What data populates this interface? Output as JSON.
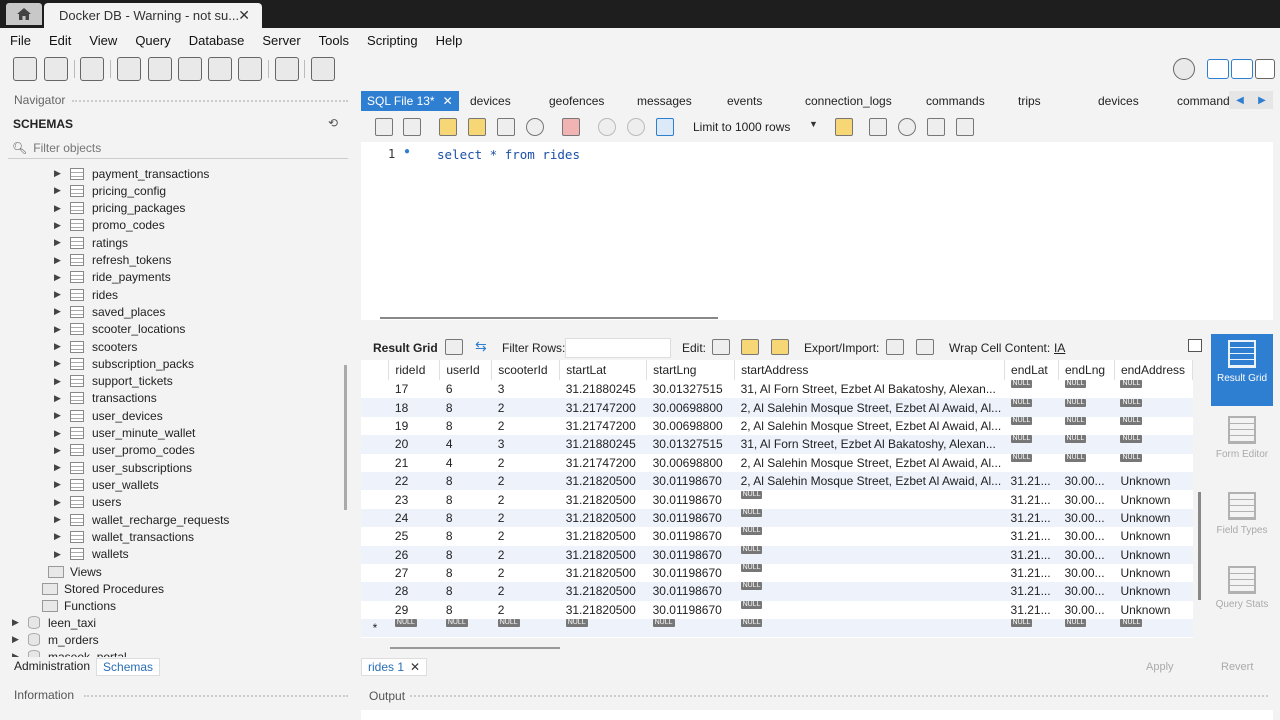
{
  "window": {
    "tab_title": "Docker DB - Warning - not su...",
    "close_glyph": "✕"
  },
  "menu": [
    "File",
    "Edit",
    "View",
    "Query",
    "Database",
    "Server",
    "Tools",
    "Scripting",
    "Help"
  ],
  "navigator": {
    "title": "Navigator",
    "schemas_label": "SCHEMAS",
    "filter_placeholder": "Filter objects",
    "tables": [
      "payment_transactions",
      "pricing_config",
      "pricing_packages",
      "promo_codes",
      "ratings",
      "refresh_tokens",
      "ride_payments",
      "rides",
      "saved_places",
      "scooter_locations",
      "scooters",
      "subscription_packs",
      "support_tickets",
      "transactions",
      "user_devices",
      "user_minute_wallet",
      "user_promo_codes",
      "user_subscriptions",
      "user_wallets",
      "users",
      "wallet_recharge_requests",
      "wallet_transactions",
      "wallets"
    ],
    "folders": [
      "Views",
      "Stored Procedures",
      "Functions"
    ],
    "schemas": [
      "leen_taxi",
      "m_orders",
      "maseek_portal"
    ],
    "bottom_tabs": [
      "Administration",
      "Schemas"
    ],
    "info_title": "Information"
  },
  "editor_tabs": [
    "SQL File 13*",
    "devices",
    "geofences",
    "messages",
    "events",
    "connection_logs",
    "commands",
    "trips",
    "devices",
    "command"
  ],
  "editor_toolbar": {
    "limit_label": "Limit to 1000 rows"
  },
  "editor": {
    "line_number": "1",
    "sql": "select * from rides"
  },
  "result_toolbar": {
    "result_grid": "Result Grid",
    "filter_rows": "Filter Rows:",
    "edit": "Edit:",
    "export_import": "Export/Import:",
    "wrap_cell": "Wrap Cell Content:"
  },
  "grid": {
    "columns": [
      "rideId",
      "userId",
      "scooterId",
      "startLat",
      "startLng",
      "startAddress",
      "endLat",
      "endLng",
      "endAddress"
    ],
    "null_label": "NULL",
    "rows": [
      [
        "17",
        "6",
        "3",
        "31.21880245",
        "30.01327515",
        "31, Al Forn Street, Ezbet Al Bakatoshy, Alexan...",
        "NULL",
        "NULL",
        "NULL"
      ],
      [
        "18",
        "8",
        "2",
        "31.21747200",
        "30.00698800",
        "2, Al Salehin Mosque Street, Ezbet Al Awaid, Al...",
        "NULL",
        "NULL",
        "NULL"
      ],
      [
        "19",
        "8",
        "2",
        "31.21747200",
        "30.00698800",
        "2, Al Salehin Mosque Street, Ezbet Al Awaid, Al...",
        "NULL",
        "NULL",
        "NULL"
      ],
      [
        "20",
        "4",
        "3",
        "31.21880245",
        "30.01327515",
        "31, Al Forn Street, Ezbet Al Bakatoshy, Alexan...",
        "NULL",
        "NULL",
        "NULL"
      ],
      [
        "21",
        "4",
        "2",
        "31.21747200",
        "30.00698800",
        "2, Al Salehin Mosque Street, Ezbet Al Awaid, Al...",
        "NULL",
        "NULL",
        "NULL"
      ],
      [
        "22",
        "8",
        "2",
        "31.21820500",
        "30.01198670",
        "2, Al Salehin Mosque Street, Ezbet Al Awaid, Al...",
        "31.21...",
        "30.00...",
        "Unknown"
      ],
      [
        "23",
        "8",
        "2",
        "31.21820500",
        "30.01198670",
        "NULL",
        "31.21...",
        "30.00...",
        "Unknown"
      ],
      [
        "24",
        "8",
        "2",
        "31.21820500",
        "30.01198670",
        "NULL",
        "31.21...",
        "30.00...",
        "Unknown"
      ],
      [
        "25",
        "8",
        "2",
        "31.21820500",
        "30.01198670",
        "NULL",
        "31.21...",
        "30.00...",
        "Unknown"
      ],
      [
        "26",
        "8",
        "2",
        "31.21820500",
        "30.01198670",
        "NULL",
        "31.21...",
        "30.00...",
        "Unknown"
      ],
      [
        "27",
        "8",
        "2",
        "31.21820500",
        "30.01198670",
        "NULL",
        "31.21...",
        "30.00...",
        "Unknown"
      ],
      [
        "28",
        "8",
        "2",
        "31.21820500",
        "30.01198670",
        "NULL",
        "31.21...",
        "30.00...",
        "Unknown"
      ],
      [
        "29",
        "8",
        "2",
        "31.21820500",
        "30.01198670",
        "NULL",
        "31.21...",
        "30.00...",
        "Unknown"
      ],
      [
        "NULL",
        "NULL",
        "NULL",
        "NULL",
        "NULL",
        "NULL",
        "NULL",
        "NULL",
        "NULL"
      ]
    ],
    "new_row_marker": "*"
  },
  "right_panel": [
    "Result Grid",
    "Form Editor",
    "Field Types",
    "Query Stats"
  ],
  "result_tab": "rides 1",
  "buttons": {
    "apply": "Apply",
    "revert": "Revert"
  },
  "output": {
    "title": "Output"
  },
  "colors": {
    "accent": "#2e7fd1",
    "titlebar": "#1e1e1e",
    "sql_keyword": "#1c4fa8"
  }
}
